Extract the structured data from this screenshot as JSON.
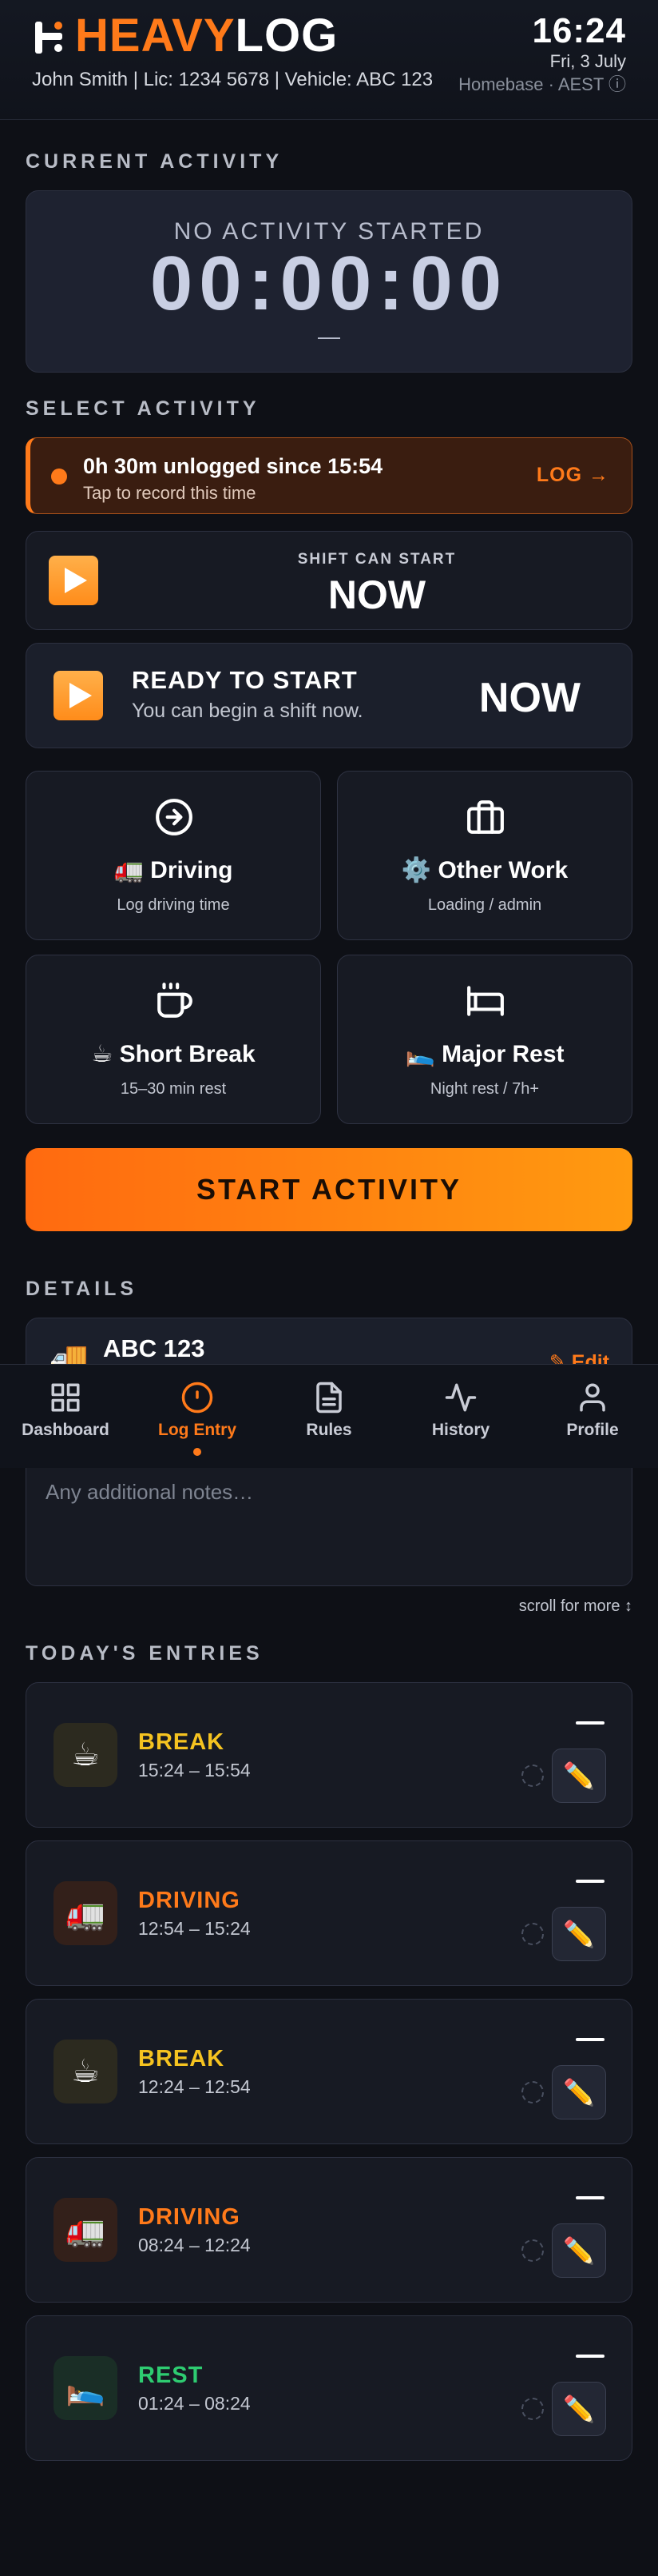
{
  "header": {
    "brand_part1": "HEAVY",
    "brand_part2": "LOG",
    "driver_info": "John Smith | Lic: 1234 5678 | Vehicle: ABC 123",
    "time": "16:24",
    "date": "Fri, 3 July",
    "zone": "Homebase · AEST ⓘ"
  },
  "current_activity": {
    "section_title": "CURRENT ACTIVITY",
    "status": "NO ACTIVITY STARTED",
    "timer": "00:00:00",
    "detail": "—"
  },
  "select_activity": {
    "section_title": "SELECT ACTIVITY",
    "alert": {
      "title": "0h 30m unlogged since 15:54",
      "subtitle": "Tap to record this time",
      "action": "LOG →"
    },
    "shift_start": {
      "label": "SHIFT CAN START",
      "value": "NOW"
    },
    "ready": {
      "title": "READY TO START",
      "subtitle": "You can begin a shift now.",
      "value": "NOW"
    },
    "activities": [
      {
        "name": "🚛 Driving",
        "sub": "Log driving time",
        "icon": "arrow-circle-icon"
      },
      {
        "name": "⚙️ Other Work",
        "sub": "Loading / admin",
        "icon": "briefcase-icon"
      },
      {
        "name": "☕ Short Break",
        "sub": "15–30 min rest",
        "icon": "coffee-icon"
      },
      {
        "name": "🛌 Major Rest",
        "sub": "Night rest / 7h+",
        "icon": "bed-icon"
      }
    ],
    "start_button": "START ACTIVITY"
  },
  "details": {
    "section_title": "DETAILS",
    "vehicle": "ABC 123",
    "vehicle_icon": "🚚",
    "edit_label": "✎ Edit",
    "notes_placeholder": "Any additional notes…",
    "scroll_hint": "scroll for more ↕"
  },
  "nav": {
    "items": [
      {
        "label": "Dashboard",
        "icon": "grid-icon"
      },
      {
        "label": "Log Entry",
        "icon": "clock-icon",
        "active": true
      },
      {
        "label": "Rules",
        "icon": "document-icon"
      },
      {
        "label": "History",
        "icon": "activity-icon"
      },
      {
        "label": "Profile",
        "icon": "user-icon"
      }
    ]
  },
  "entries": {
    "section_title": "TODAY'S ENTRIES",
    "items": [
      {
        "type": "BREAK",
        "range": "15:24 – 15:54",
        "emoji": "☕",
        "color": "#f5c320",
        "bg": "#2c2a1f"
      },
      {
        "type": "DRIVING",
        "range": "12:54 – 15:24",
        "emoji": "🚛",
        "color": "#ff7a1a",
        "bg": "#33201a"
      },
      {
        "type": "BREAK",
        "range": "12:24 – 12:54",
        "emoji": "☕",
        "color": "#f5c320",
        "bg": "#2c2a1f"
      },
      {
        "type": "DRIVING",
        "range": "08:24 – 12:24",
        "emoji": "🚛",
        "color": "#ff7a1a",
        "bg": "#33201a"
      },
      {
        "type": "REST",
        "range": "01:24 – 08:24",
        "emoji": "🛌",
        "color": "#2ecc71",
        "bg": "#1a2e26"
      }
    ],
    "edit_icon": "✏️"
  },
  "colors": {
    "accent": "#ff7a1a",
    "background": "#0e1016",
    "card": "#171a23"
  }
}
